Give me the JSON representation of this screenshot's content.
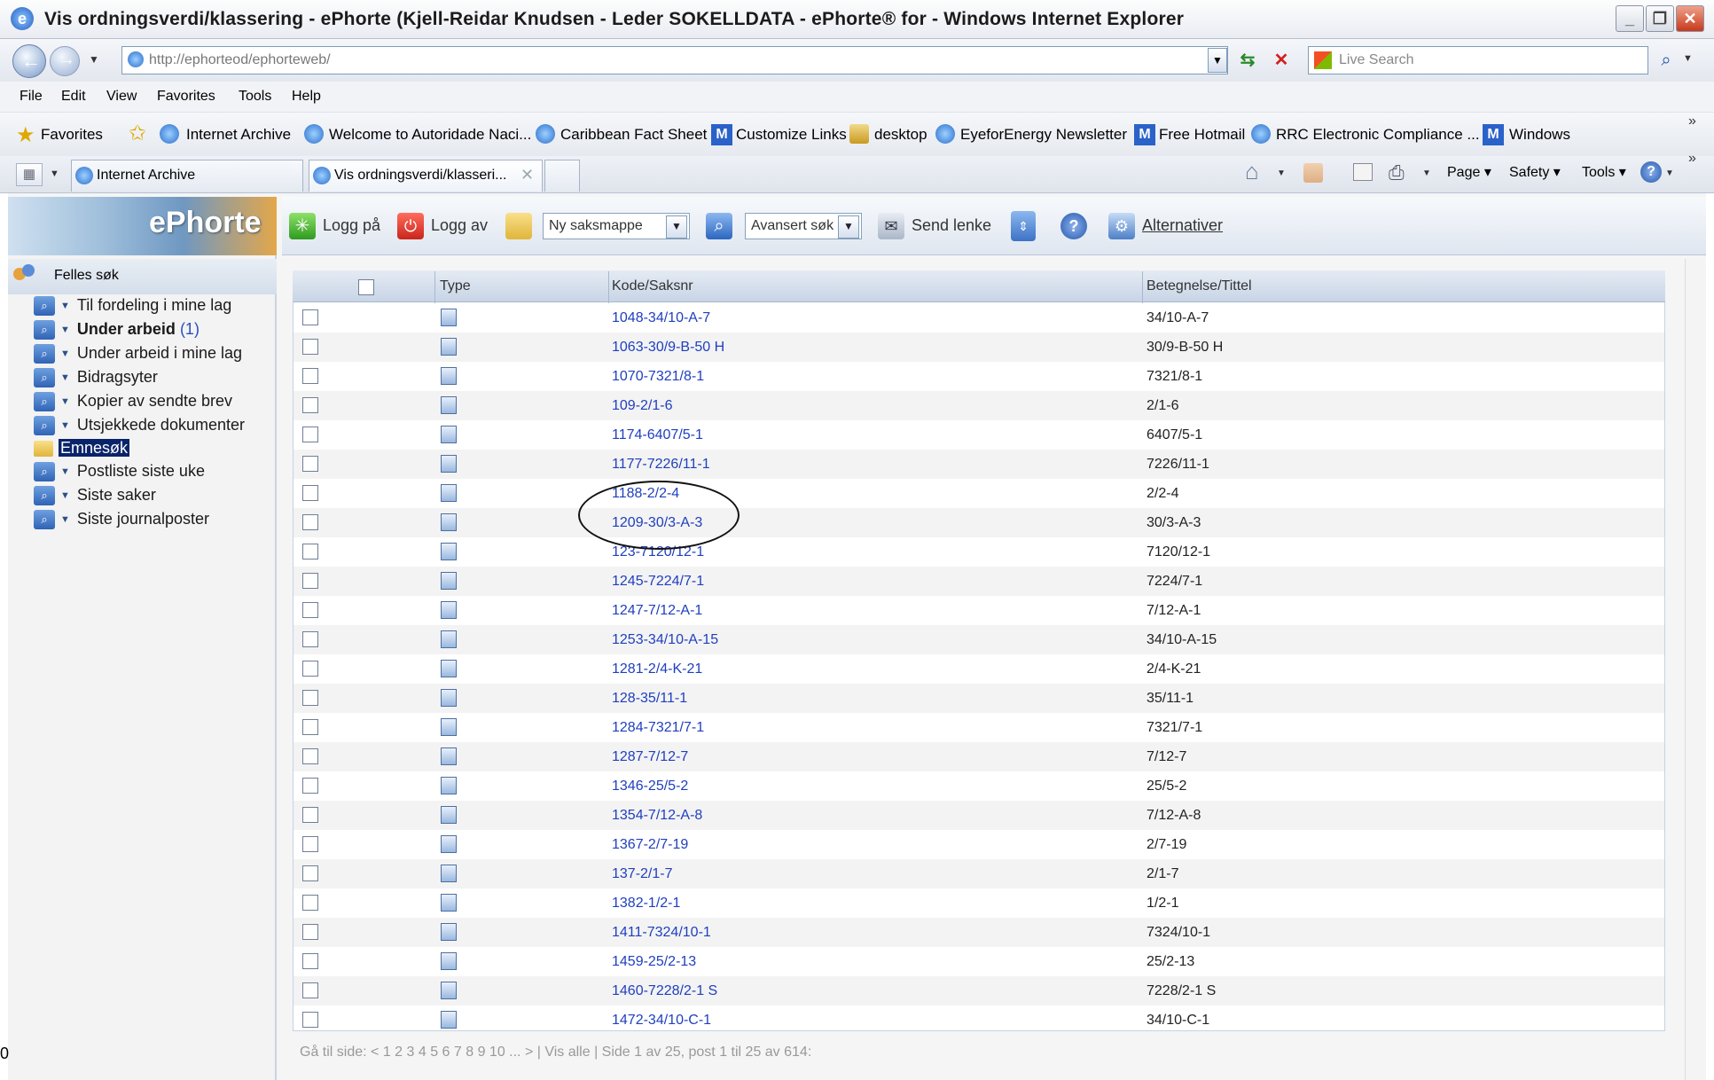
{
  "window": {
    "title": "Vis ordningsverdi/klassering - ePhorte (Kjell-Reidar Knudsen - Leder SOKELLDATA - ePhorte® for  - Windows Internet Explorer"
  },
  "address": {
    "url": "http://ephorteod/ephorteweb/"
  },
  "search": {
    "placeholder": "Live Search"
  },
  "menu": [
    "File",
    "Edit",
    "View",
    "Favorites",
    "Tools",
    "Help"
  ],
  "favorites": {
    "label": "Favorites",
    "items": [
      "Internet Archive",
      "Welcome to Autoridade Naci...",
      "Caribbean Fact Sheet",
      "Customize Links",
      "desktop",
      "EyeforEnergy Newsletter",
      "Free Hotmail",
      "RRC Electronic Compliance ...",
      "Windows"
    ]
  },
  "tabs": [
    "Internet Archive",
    "Vis ordningsverdi/klasseri..."
  ],
  "commands": [
    "Page",
    "Safety",
    "Tools"
  ],
  "app": {
    "logo": "ePhorte",
    "toolbar": {
      "login": "Logg på",
      "logout": "Logg av",
      "new_case": "Ny saksmappe",
      "advanced_search": "Avansert søk",
      "send_link": "Send lenke",
      "options": "Alternativer"
    },
    "left": {
      "header": "Felles søk",
      "items": [
        {
          "label": "Til fordeling i mine lag",
          "count": ""
        },
        {
          "label": "Under arbeid",
          "count": "(1)"
        },
        {
          "label": "Under arbeid i mine lag",
          "count": ""
        },
        {
          "label": "Bidragsyter",
          "count": ""
        },
        {
          "label": "Kopier av sendte brev",
          "count": ""
        },
        {
          "label": "Utsjekkede dokumenter",
          "count": ""
        },
        {
          "label": "Emnesøk",
          "count": ""
        },
        {
          "label": "Postliste siste uke",
          "count": ""
        },
        {
          "label": "Siste saker",
          "count": ""
        },
        {
          "label": "Siste journalposter",
          "count": ""
        }
      ]
    },
    "grid": {
      "columns": [
        "Type",
        "Kode/Saksnr",
        "Betegnelse/Tittel"
      ],
      "rows": [
        {
          "code": "1048-34/10-A-7",
          "title": "34/10-A-7"
        },
        {
          "code": "1063-30/9-B-50 H",
          "title": "30/9-B-50 H"
        },
        {
          "code": "1070-7321/8-1",
          "title": "7321/8-1"
        },
        {
          "code": "109-2/1-6",
          "title": "2/1-6"
        },
        {
          "code": "1174-6407/5-1",
          "title": "6407/5-1"
        },
        {
          "code": "1177-7226/11-1",
          "title": "7226/11-1"
        },
        {
          "code": "1188-2/2-4",
          "title": "2/2-4"
        },
        {
          "code": "1209-30/3-A-3",
          "title": "30/3-A-3"
        },
        {
          "code": "123-7120/12-1",
          "title": "7120/12-1"
        },
        {
          "code": "1245-7224/7-1",
          "title": "7224/7-1"
        },
        {
          "code": "1247-7/12-A-1",
          "title": "7/12-A-1"
        },
        {
          "code": "1253-34/10-A-15",
          "title": "34/10-A-15"
        },
        {
          "code": "1281-2/4-K-21",
          "title": "2/4-K-21"
        },
        {
          "code": "128-35/11-1",
          "title": "35/11-1"
        },
        {
          "code": "1284-7321/7-1",
          "title": "7321/7-1"
        },
        {
          "code": "1287-7/12-7",
          "title": "7/12-7"
        },
        {
          "code": "1346-25/5-2",
          "title": "25/5-2"
        },
        {
          "code": "1354-7/12-A-8",
          "title": "7/12-A-8"
        },
        {
          "code": "1367-2/7-19",
          "title": "2/7-19"
        },
        {
          "code": "137-2/1-7",
          "title": "2/1-7"
        },
        {
          "code": "1382-1/2-1",
          "title": "1/2-1"
        },
        {
          "code": "1411-7324/10-1",
          "title": "7324/10-1"
        },
        {
          "code": "1459-25/2-13",
          "title": "25/2-13"
        },
        {
          "code": "1460-7228/2-1 S",
          "title": "7228/2-1 S"
        },
        {
          "code": "1472-34/10-C-1",
          "title": "34/10-C-1"
        }
      ]
    },
    "pager": "Gå til side: < 1 2 3 4 5 6 7 8 9 10 ... > | Vis alle | Side 1 av 25, post 1 til 25 av 614:"
  },
  "edge_mark": "0",
  "colors": {
    "link": "#1f3fbf",
    "accent": "#2f63b5"
  }
}
